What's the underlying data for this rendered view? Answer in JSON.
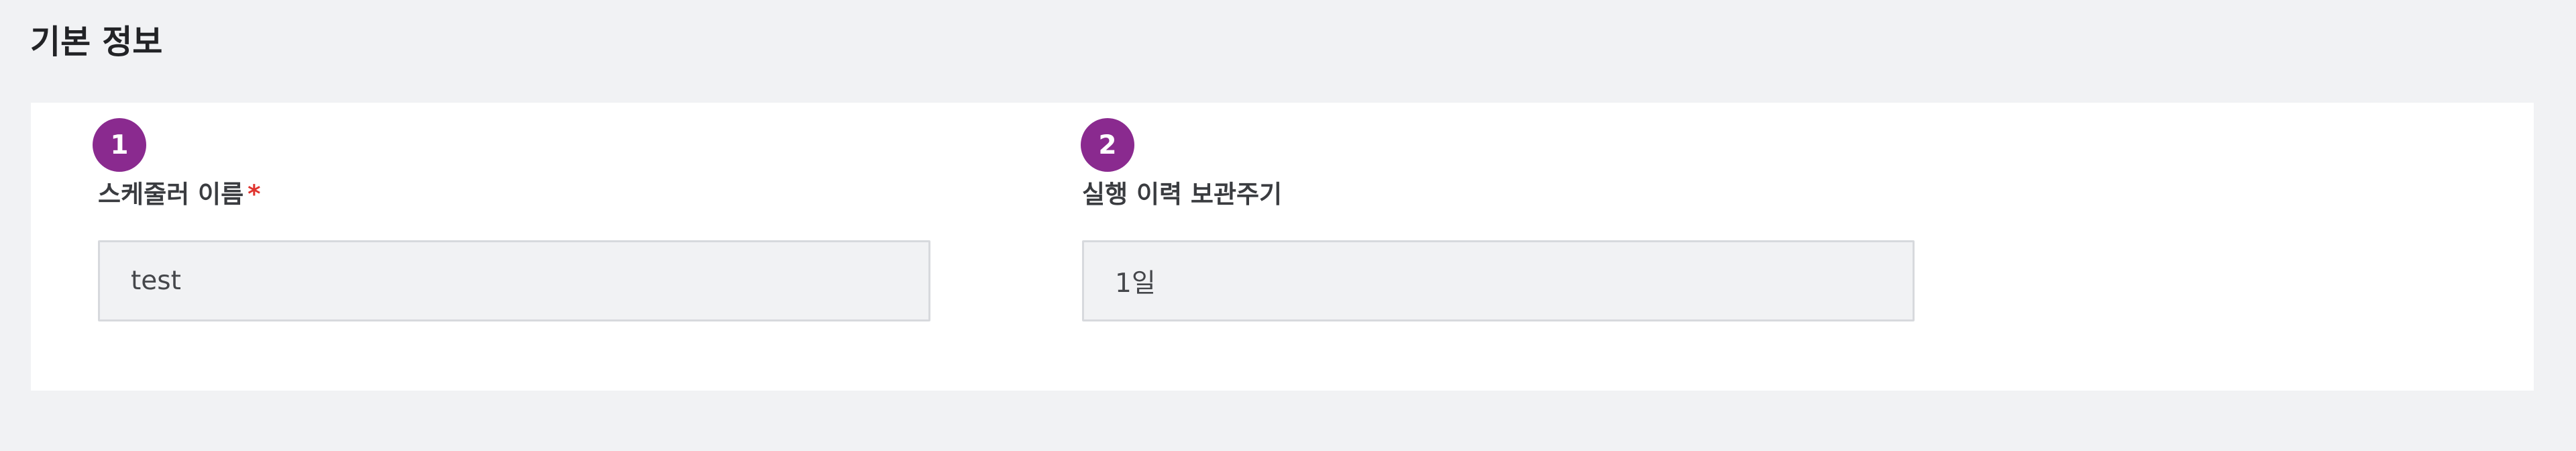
{
  "section": {
    "title": "기본 정보"
  },
  "fields": [
    {
      "step": "1",
      "label": "스케줄러 이름",
      "required_mark": "*",
      "value": "test"
    },
    {
      "step": "2",
      "label": "실행 이력 보관주기",
      "value": "1일"
    }
  ],
  "colors": {
    "page_background": "#f1f2f4",
    "card_background": "#ffffff",
    "badge": "#8a2a8f",
    "required": "#e0342f",
    "input_background": "#f1f2f4",
    "input_border": "#d7d9dd"
  }
}
